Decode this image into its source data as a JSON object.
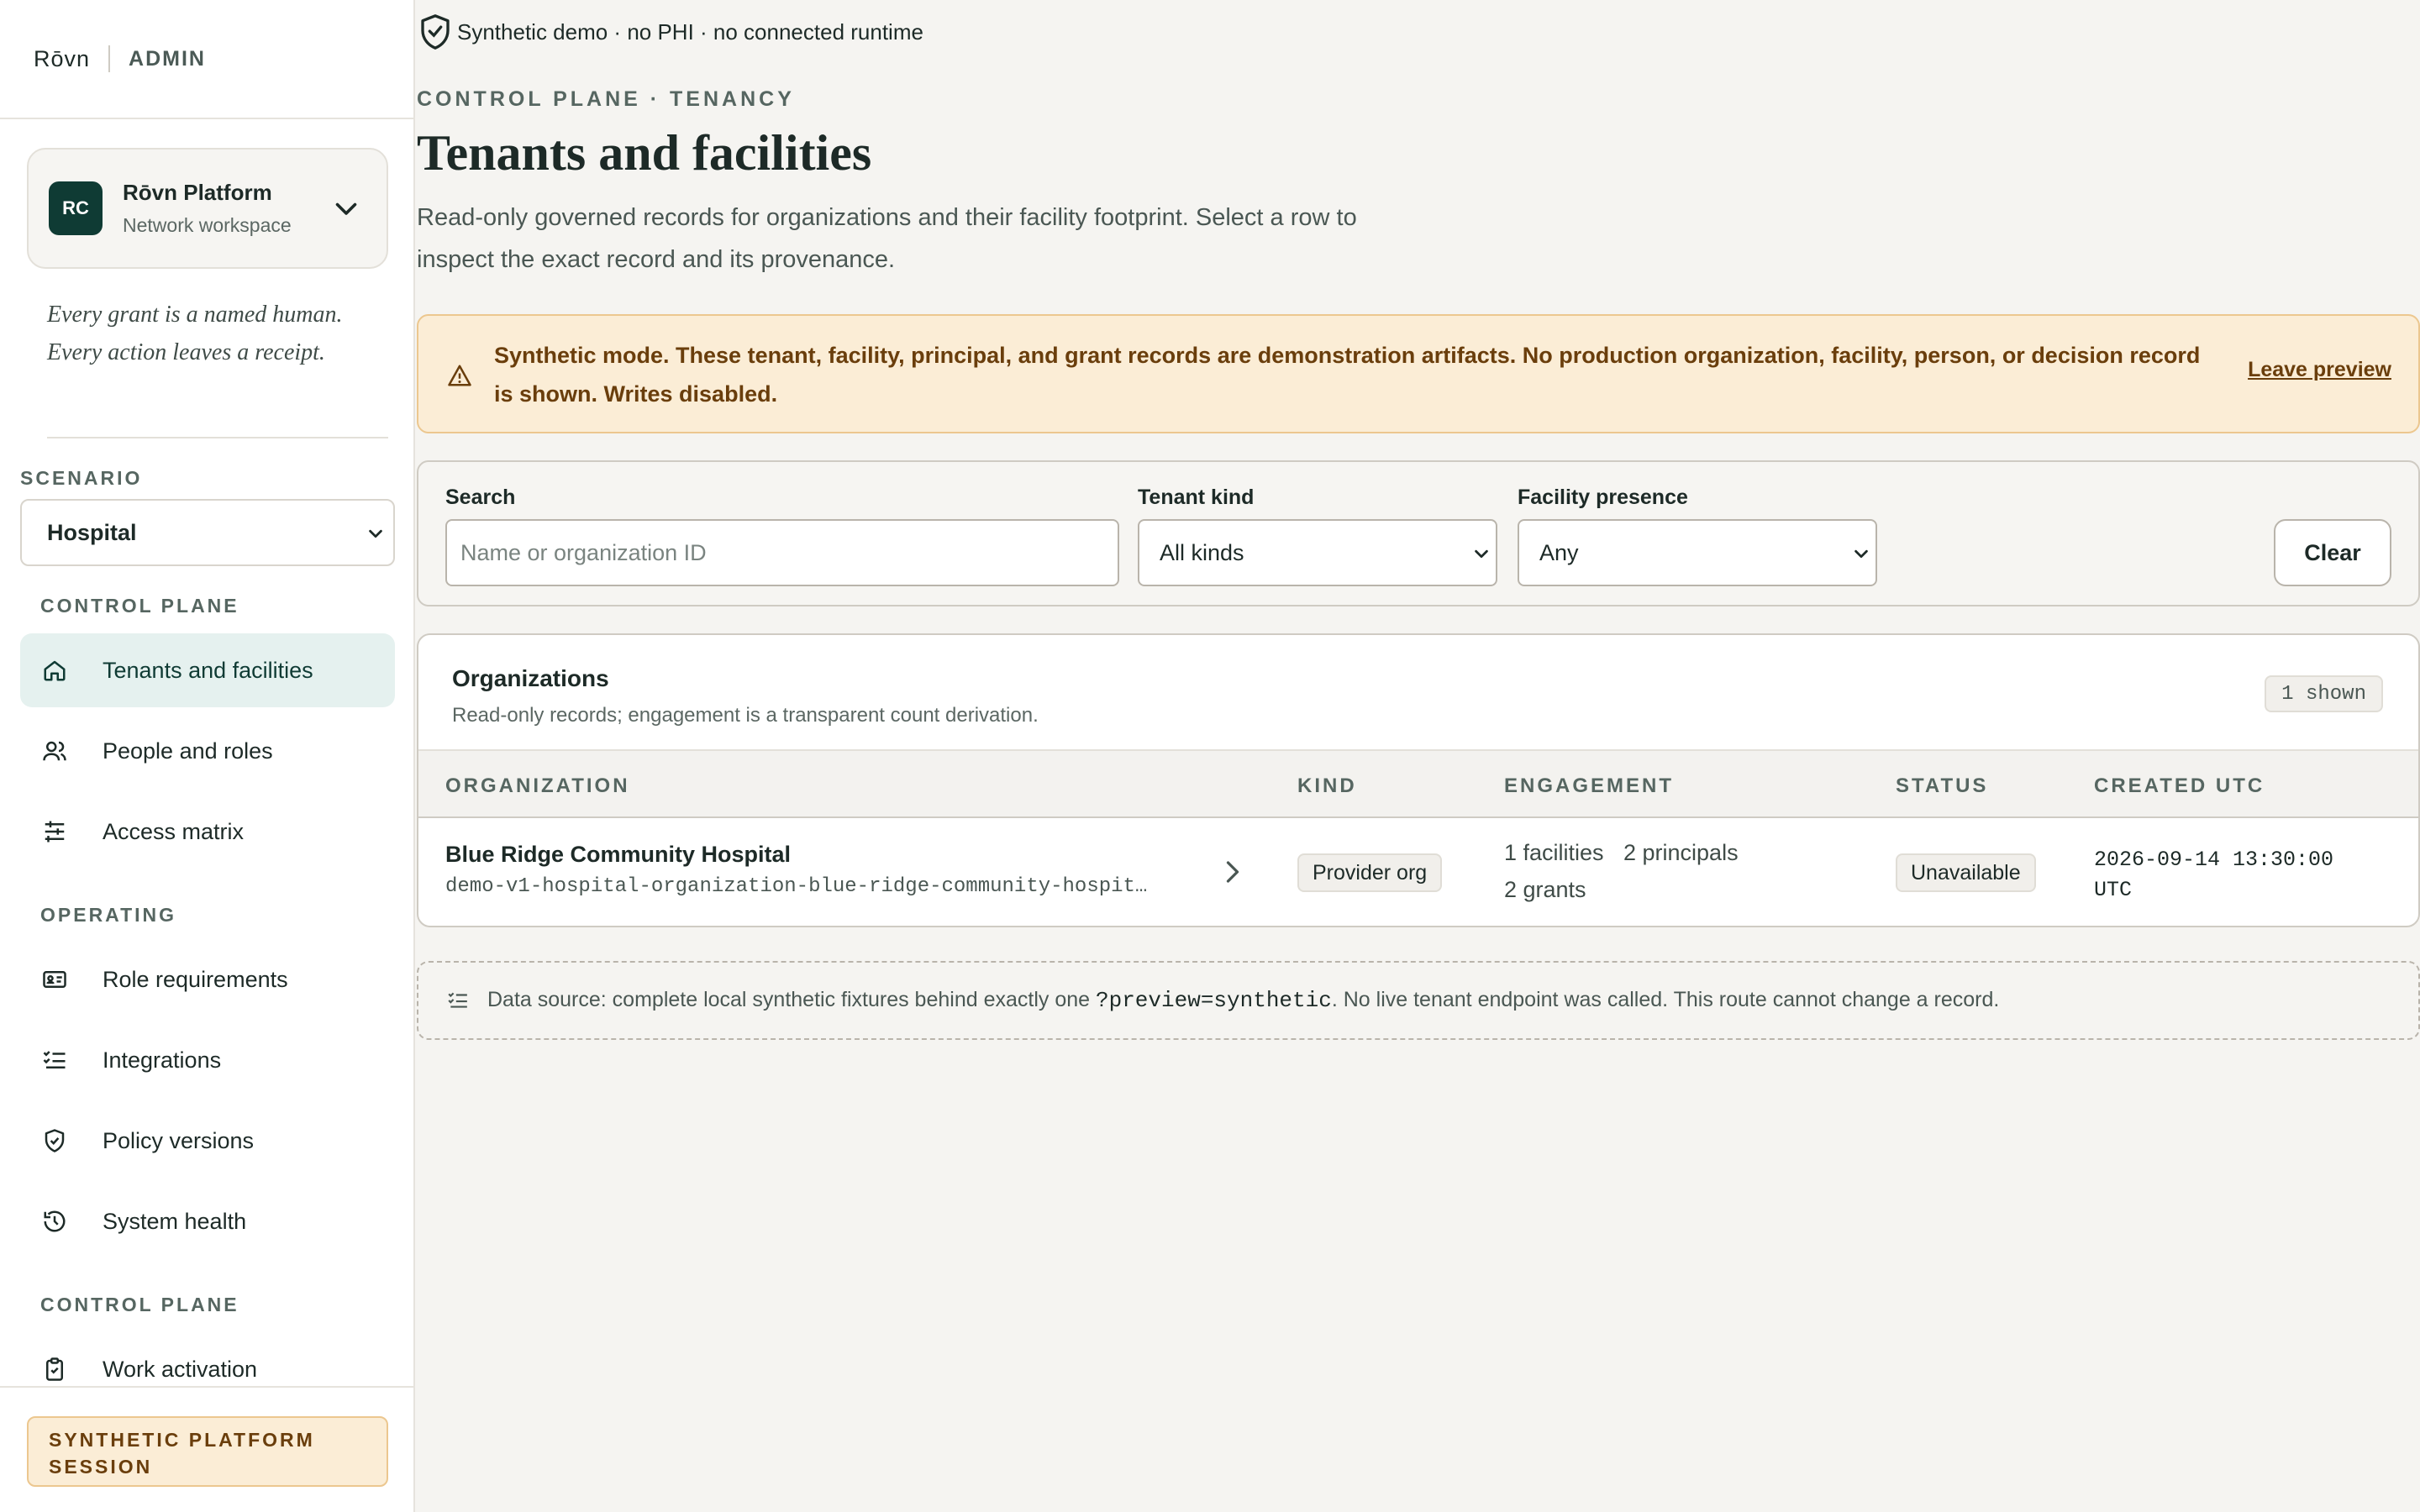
{
  "brand": {
    "logo": "Rōvn",
    "section": "ADMIN"
  },
  "workspace": {
    "initials": "RC",
    "name": "Rōvn Platform",
    "subtitle": "Network workspace"
  },
  "tagline": "Every grant is a named human. Every action leaves a receipt.",
  "scenario": {
    "heading": "SCENARIO",
    "selected": "Hospital"
  },
  "nav_sections": {
    "control_plane": "CONTROL PLANE",
    "operating": "OPERATING",
    "control_plane_2": "CONTROL PLANE"
  },
  "nav": [
    {
      "label": "Tenants and facilities",
      "icon": "home-icon",
      "active": true
    },
    {
      "label": "People and roles",
      "icon": "people-icon",
      "active": false
    },
    {
      "label": "Access matrix",
      "icon": "sliders-icon",
      "active": false
    },
    {
      "label": "Role requirements",
      "icon": "id-card-icon",
      "active": false
    },
    {
      "label": "Integrations",
      "icon": "checklist-icon",
      "active": false
    },
    {
      "label": "Policy versions",
      "icon": "shield-check-icon",
      "active": false
    },
    {
      "label": "System health",
      "icon": "history-icon",
      "active": false
    },
    {
      "label": "Work activation",
      "icon": "clipboard-check-icon",
      "active": false
    }
  ],
  "session_badge": "SYNTHETIC PLATFORM SESSION",
  "demo_banner": "Synthetic demo · no PHI · no connected runtime",
  "page": {
    "eyebrow": "CONTROL PLANE · TENANCY",
    "title": "Tenants and facilities",
    "description": "Read-only governed records for organizations and their facility footprint. Select a row to inspect the exact record and its provenance."
  },
  "alert": {
    "text": "Synthetic mode. These tenant, facility, principal, and grant records are demonstration artifacts. No production organization, facility, person, or decision record is shown. Writes disabled.",
    "link": "Leave preview"
  },
  "filters": {
    "search_label": "Search",
    "search_placeholder": "Name or organization ID",
    "search_value": "",
    "kind_label": "Tenant kind",
    "kind_value": "All kinds",
    "presence_label": "Facility presence",
    "presence_value": "Any",
    "clear_label": "Clear"
  },
  "organizations": {
    "title": "Organizations",
    "subtitle": "Read-only records; engagement is a transparent count derivation.",
    "count": "1 shown",
    "columns": [
      "ORGANIZATION",
      "KIND",
      "ENGAGEMENT",
      "STATUS",
      "CREATED UTC"
    ],
    "rows": [
      {
        "name": "Blue Ridge Community Hospital",
        "id": "demo-v1-hospital-organization-blue-ridge-community-hospit…",
        "kind": "Provider org",
        "facilities": "1 facilities",
        "principals": "2 principals",
        "grants": "2 grants",
        "status": "Unavailable",
        "created": "2026-09-14 13:30:00 UTC"
      }
    ]
  },
  "source": {
    "prefix": "Data source: complete local synthetic fixtures behind exactly one",
    "code": "?preview=synthetic",
    "suffix": ". No live tenant endpoint was called. This route cannot change a record."
  }
}
